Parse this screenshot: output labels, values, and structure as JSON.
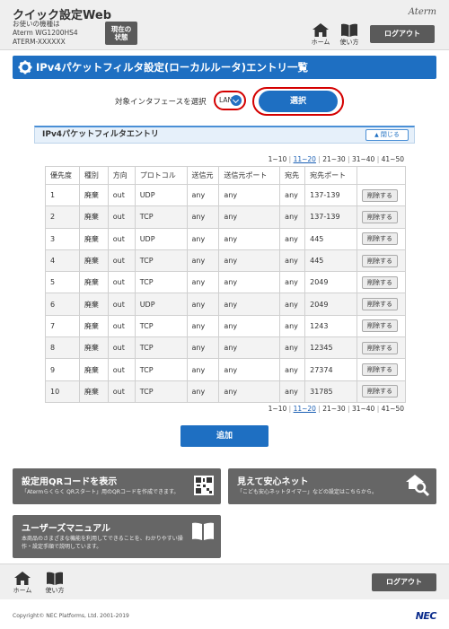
{
  "header": {
    "app_title": "クイック設定Web",
    "device_line1": "お使いの機種は",
    "device_line2": "Aterm WG1200HS4",
    "device_line3": "ATERM-XXXXXX",
    "status_btn_line1": "現在の",
    "status_btn_line2": "状態",
    "brand": "Aterm",
    "home_label": "ホーム",
    "manual_label": "使い方",
    "logout_label": "ログアウト"
  },
  "page": {
    "title": "IPv4パケットフィルタ設定(ローカルルータ)エントリ一覧",
    "interface_label": "対象インタフェースを選択",
    "interface_value": "LAN",
    "select_button": "選択",
    "panel_title": "IPv4パケットフィルタエントリ",
    "close_button": "閉じる",
    "add_button": "追加"
  },
  "pager": {
    "items": [
      "1~10",
      "11~20",
      "21~30",
      "31~40",
      "41~50"
    ],
    "separator": "|"
  },
  "table": {
    "headers": [
      "優先度",
      "種別",
      "方向",
      "プロトコル",
      "送信元",
      "送信元ポート",
      "宛先",
      "宛先ポート",
      ""
    ],
    "delete_label": "削除する",
    "rows": [
      [
        "1",
        "廃棄",
        "out",
        "UDP",
        "any",
        "any",
        "any",
        "137-139"
      ],
      [
        "2",
        "廃棄",
        "out",
        "TCP",
        "any",
        "any",
        "any",
        "137-139"
      ],
      [
        "3",
        "廃棄",
        "out",
        "UDP",
        "any",
        "any",
        "any",
        "445"
      ],
      [
        "4",
        "廃棄",
        "out",
        "TCP",
        "any",
        "any",
        "any",
        "445"
      ],
      [
        "5",
        "廃棄",
        "out",
        "TCP",
        "any",
        "any",
        "any",
        "2049"
      ],
      [
        "6",
        "廃棄",
        "out",
        "UDP",
        "any",
        "any",
        "any",
        "2049"
      ],
      [
        "7",
        "廃棄",
        "out",
        "TCP",
        "any",
        "any",
        "any",
        "1243"
      ],
      [
        "8",
        "廃棄",
        "out",
        "TCP",
        "any",
        "any",
        "any",
        "12345"
      ],
      [
        "9",
        "廃棄",
        "out",
        "TCP",
        "any",
        "any",
        "any",
        "27374"
      ],
      [
        "10",
        "廃棄",
        "out",
        "TCP",
        "any",
        "any",
        "any",
        "31785"
      ]
    ]
  },
  "cards": {
    "qr_title": "設定用QRコードを表示",
    "qr_desc": "「Atermらくらく QRスタート」用のQRコードを作成できます。",
    "safety_title": "見えて安心ネット",
    "safety_desc": "「こども安心ネットタイマー」などの設定はこちらから。",
    "manual_title": "ユーザーズマニュアル",
    "manual_desc1": "本商品のさまざまな機能を利用してできることを、わかりやすい操",
    "manual_desc2": "作・設定手順で説明しています。"
  },
  "footer": {
    "home_label": "ホーム",
    "manual_label": "使い方",
    "logout_label": "ログアウト",
    "copyright": "Copyright© NEC Platforms, Ltd. 2001-2019",
    "logo": "NEC"
  },
  "colors": {
    "primary": "#1e6fc2",
    "highlight_ring": "#d40000",
    "card_bg": "#666666",
    "header_bg": "#efefef"
  },
  "icons": [
    "home-icon",
    "book-icon",
    "gear-icon",
    "chevron-down-icon",
    "chevron-up-icon",
    "qr-code-icon",
    "search-house-icon"
  ]
}
